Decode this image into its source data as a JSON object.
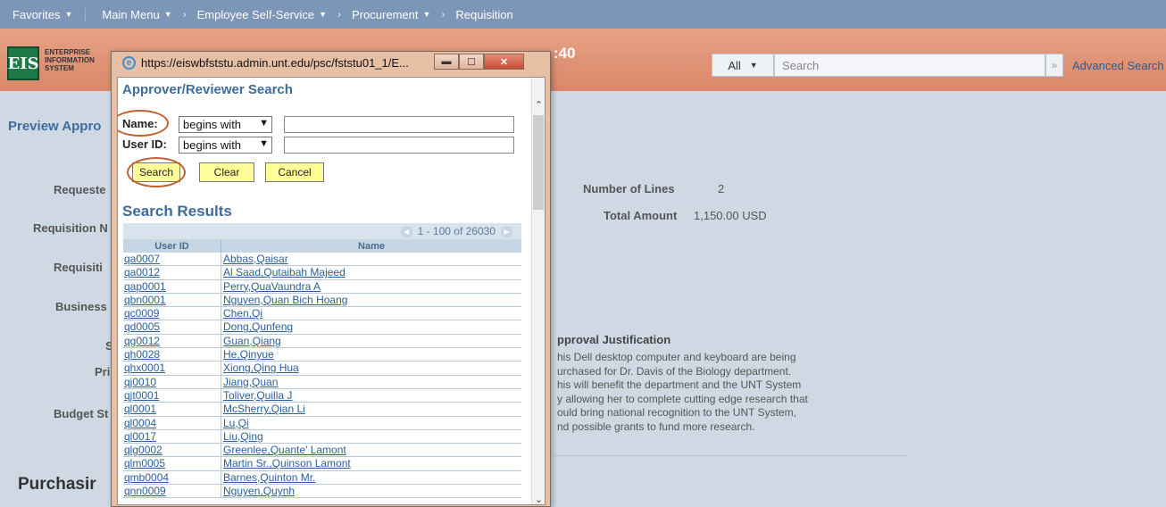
{
  "navbar": {
    "favorites": "Favorites",
    "main_menu": "Main Menu",
    "crumbs": [
      "Employee Self-Service",
      "Procurement",
      "Requisition"
    ]
  },
  "header": {
    "logo": "EIS",
    "logo_text_1": "ENTERPRISE",
    "logo_text_2": "INFORMATION",
    "logo_text_3": "SYSTEM",
    "time_fragment": ":40",
    "search_scope": "All",
    "search_placeholder": "Search",
    "advanced_search": "Advanced Search"
  },
  "page": {
    "title_fragment": "Preview Appro",
    "labels": {
      "requester": "Requeste",
      "requisition_name": "Requisition N",
      "requisition": "Requisiti",
      "business": "Business",
      "s": "S",
      "pri": "Pri",
      "budget": "Budget St"
    },
    "number_of_lines_label": "Number of Lines",
    "number_of_lines": "2",
    "total_amount_label": "Total Amount",
    "total_amount": "1,150.00 USD",
    "justification_title": "pproval Justification",
    "justification_lines": [
      "his Dell desktop computer and keyboard are being",
      "urchased for Dr. Davis of the Biology department.",
      "his will benefit the department and the UNT System",
      "y allowing her to complete cutting edge research that",
      "ould bring national recognition to the UNT System,",
      "nd possible grants to fund more research."
    ],
    "purchasing_fragment": "Purchasir"
  },
  "popup": {
    "url": "https://eiswbfststu.admin.unt.edu/psc/fststu01_1/E...",
    "title": "Approver/Reviewer Search",
    "name_label": "Name:",
    "userid_label": "User ID:",
    "name_operator": "begins with",
    "userid_operator": "begins with",
    "search_button": "Search",
    "clear_button": "Clear",
    "cancel_button": "Cancel",
    "results_title": "Search Results",
    "pagination": "1 - 100 of 26030",
    "col_userid": "User ID",
    "col_name": "Name",
    "rows": [
      {
        "uid": "qa0007",
        "name": "Abbas,Qaisar"
      },
      {
        "uid": "qa0012",
        "name": "Al Saad,Qutaibah Majeed"
      },
      {
        "uid": "qap0001",
        "name": "Perry,QuaVaundra A"
      },
      {
        "uid": "qbn0001",
        "name": "Nguyen,Quan Bich Hoang"
      },
      {
        "uid": "qc0009",
        "name": "Chen,Qi"
      },
      {
        "uid": "qd0005",
        "name": "Dong,Qunfeng"
      },
      {
        "uid": "qg0012",
        "name": "Guan,Qiang"
      },
      {
        "uid": "qh0028",
        "name": "He,Qinyue"
      },
      {
        "uid": "qhx0001",
        "name": "Xiong,Qing Hua"
      },
      {
        "uid": "qj0010",
        "name": "Jiang,Quan"
      },
      {
        "uid": "qjt0001",
        "name": "Toliver,Quilla J"
      },
      {
        "uid": "ql0001",
        "name": "McSherry,Qian Li"
      },
      {
        "uid": "ql0004",
        "name": "Lu,Qi"
      },
      {
        "uid": "ql0017",
        "name": "Liu,Qing"
      },
      {
        "uid": "qlg0002",
        "name": "Greenlee,Quante' Lamont"
      },
      {
        "uid": "qlm0005",
        "name": "Martin Sr.,Quinson Lamont"
      },
      {
        "uid": "qmb0004",
        "name": "Barnes,Quinton Mr."
      },
      {
        "uid": "qnn0009",
        "name": "Nguyen,Quynh"
      }
    ]
  },
  "colors": {
    "nav_bg": "#7c96b8",
    "header_bg": "#d9876a",
    "title_blue": "#3e6b9e",
    "button_yellow": "#ffff99",
    "highlight_circle": "#c0602a"
  }
}
